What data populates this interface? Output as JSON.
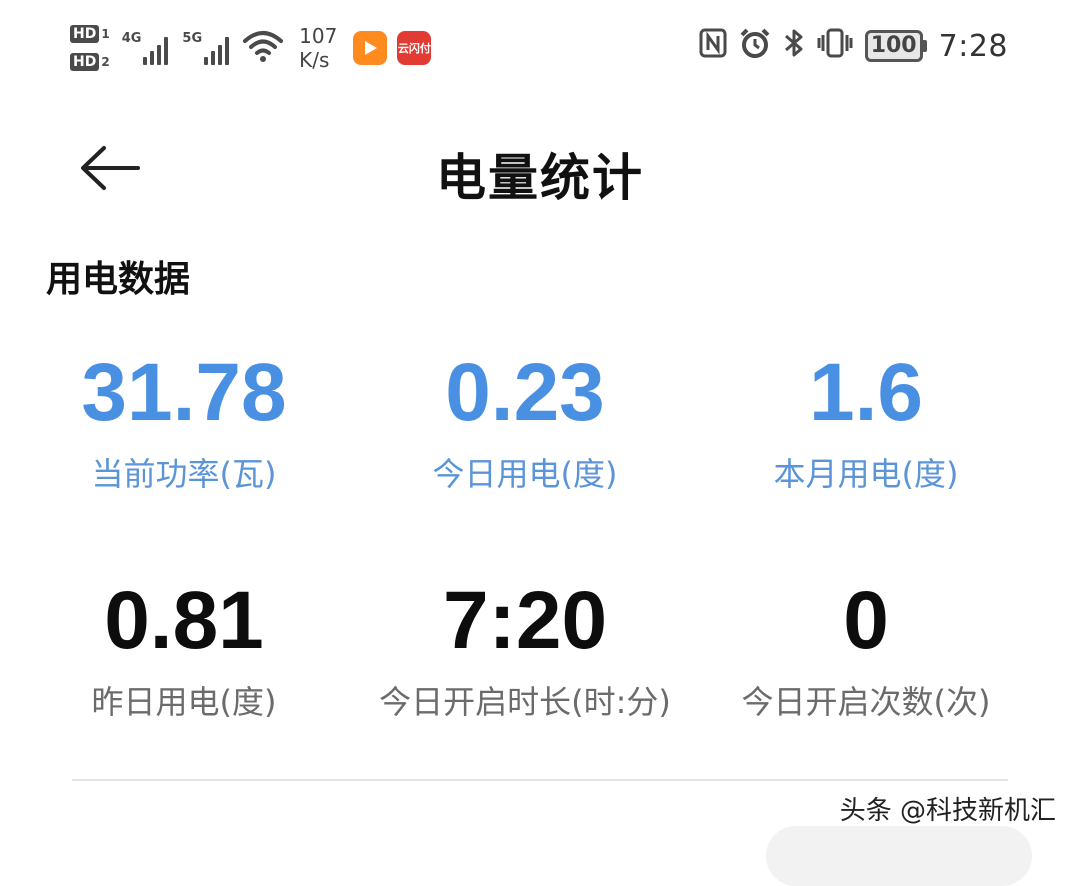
{
  "status_bar": {
    "sim1": "HD",
    "sim1_index": "1",
    "sim2": "HD",
    "sim2_index": "2",
    "network1": "4G",
    "network2": "5G",
    "speed_value": "107",
    "speed_unit": "K/s",
    "pay_app_label": "云闪付",
    "battery": "100",
    "time": "7:28",
    "icons": [
      "hd-icon",
      "signal-icon",
      "wifi-icon",
      "video-app-icon",
      "unionpay-icon",
      "nfc-icon",
      "alarm-icon",
      "bluetooth-icon",
      "vibrate-icon",
      "battery-icon"
    ]
  },
  "header": {
    "title": "电量统计",
    "back_icon": "arrow-left-icon"
  },
  "section": {
    "title": "用电数据"
  },
  "stats": [
    {
      "value": "31.78",
      "label": "当前功率(瓦)"
    },
    {
      "value": "0.23",
      "label": "今日用电(度)"
    },
    {
      "value": "1.6",
      "label": "本月用电(度)"
    },
    {
      "value": "0.81",
      "label": "昨日用电(度)"
    },
    {
      "value": "7:20",
      "label": "今日开启时长(时:分)"
    },
    {
      "value": "0",
      "label": "今日开启次数(次)"
    }
  ],
  "watermark": "头条 @科技新机汇",
  "colors": {
    "accent": "#4a90e2",
    "text": "#111111",
    "muted": "#6b6b6b"
  }
}
